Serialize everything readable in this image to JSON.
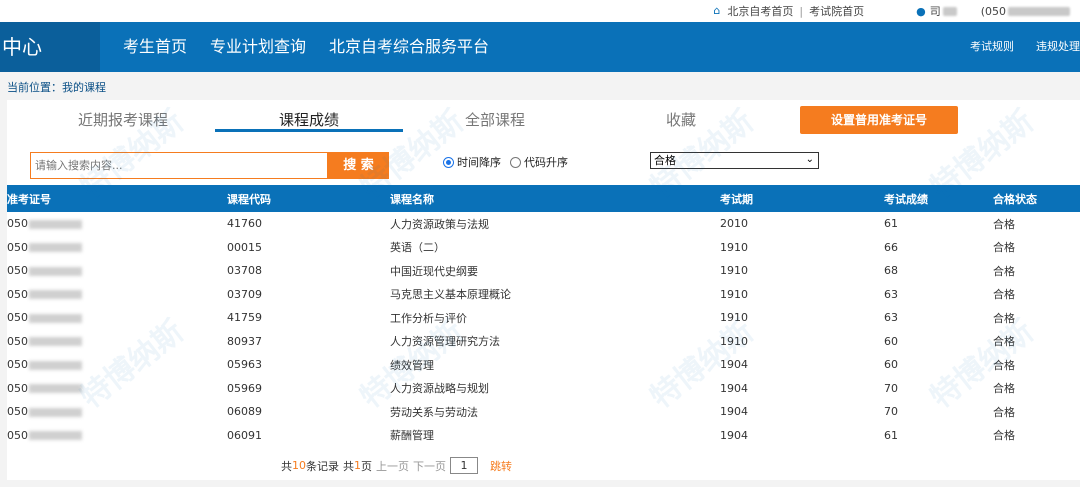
{
  "topbar": {
    "link_home": "北京自考首页",
    "link_exam": "考试院首页",
    "user_prefix": "司",
    "user_id_prefix": "(050"
  },
  "navbar": {
    "brand": "中心",
    "links": [
      "考生首页",
      "专业计划查询",
      "北京自考综合服务平台"
    ],
    "right_links": [
      "考试规则",
      "违规处理"
    ]
  },
  "breadcrumb": "当前位置：我的课程",
  "tabs": [
    "近期报考课程",
    "课程成绩",
    "全部课程",
    "收藏"
  ],
  "active_tab": "课程成绩",
  "cert_button": "设置普用准考证号",
  "search": {
    "placeholder": "请输入搜索内容...",
    "button": "搜 索",
    "sort_time": "时间降序",
    "sort_code": "代码升序",
    "filter": "合格"
  },
  "table": {
    "headers": [
      "准考证号",
      "课程代码",
      "课程名称",
      "考试期",
      "考试成绩",
      "合格状态"
    ],
    "id_prefix": "050",
    "rows": [
      {
        "code": "41760",
        "name": "人力资源政策与法规",
        "period": "2010",
        "score": "61",
        "status": "合格"
      },
      {
        "code": "00015",
        "name": "英语（二）",
        "period": "1910",
        "score": "66",
        "status": "合格"
      },
      {
        "code": "03708",
        "name": "中国近现代史纲要",
        "period": "1910",
        "score": "68",
        "status": "合格"
      },
      {
        "code": "03709",
        "name": "马克思主义基本原理概论",
        "period": "1910",
        "score": "63",
        "status": "合格"
      },
      {
        "code": "41759",
        "name": "工作分析与评价",
        "period": "1910",
        "score": "63",
        "status": "合格"
      },
      {
        "code": "80937",
        "name": "人力资源管理研究方法",
        "period": "1910",
        "score": "60",
        "status": "合格"
      },
      {
        "code": "05963",
        "name": "绩效管理",
        "period": "1904",
        "score": "60",
        "status": "合格"
      },
      {
        "code": "05969",
        "name": "人力资源战略与规划",
        "period": "1904",
        "score": "70",
        "status": "合格"
      },
      {
        "code": "06089",
        "name": "劳动关系与劳动法",
        "period": "1904",
        "score": "70",
        "status": "合格"
      },
      {
        "code": "06091",
        "name": "薪酬管理",
        "period": "1904",
        "score": "61",
        "status": "合格"
      }
    ]
  },
  "pager": {
    "total_prefix": "共",
    "total": "10",
    "total_suffix": "条记录",
    "pages_prefix": "共",
    "pages": "1",
    "pages_suffix": "页",
    "prev": "上一页",
    "next": "下一页",
    "page": "1",
    "go": "跳转"
  },
  "watermark": "特博纳斯"
}
